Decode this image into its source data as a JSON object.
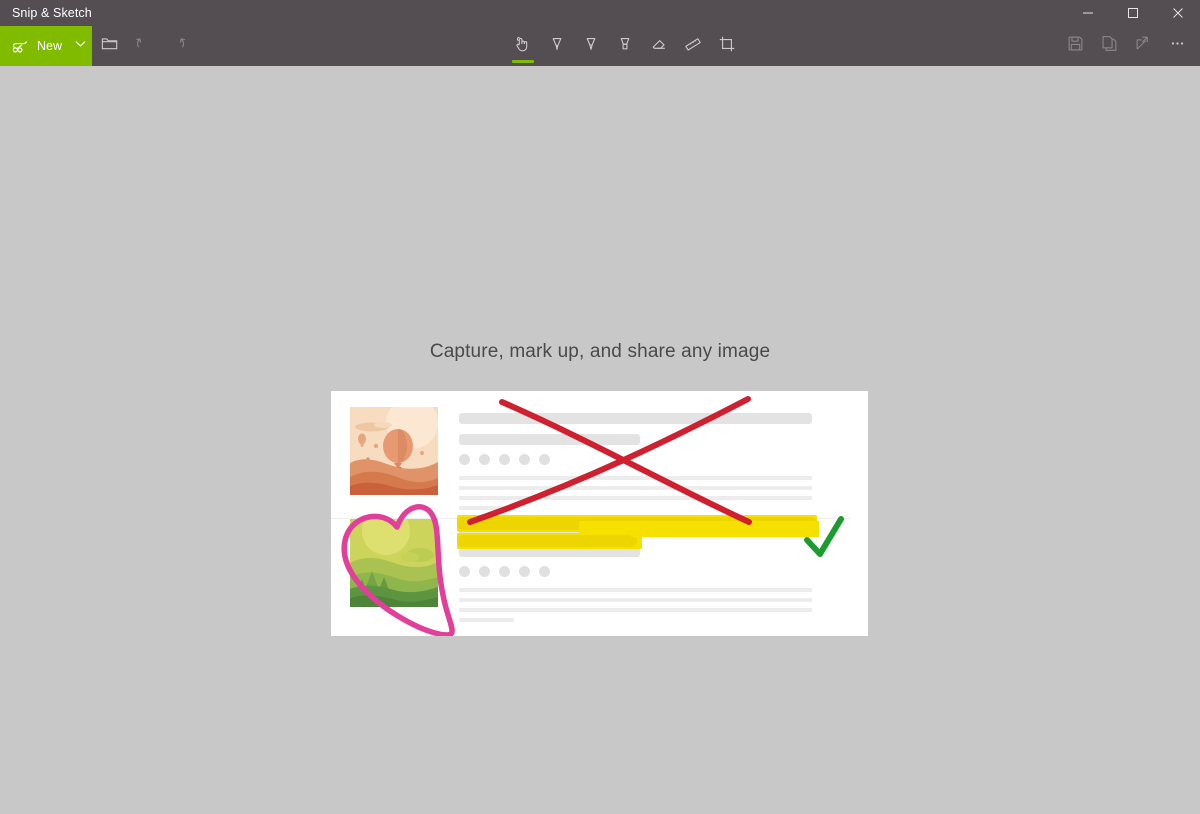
{
  "window": {
    "title": "Snip & Sketch",
    "titlebar_bg": "#544d52",
    "controls": [
      {
        "name": "minimize",
        "glyph": "minimize-icon"
      },
      {
        "name": "maximize",
        "glyph": "maximize-icon"
      },
      {
        "name": "close",
        "glyph": "close-icon"
      }
    ]
  },
  "toolbar": {
    "bg": "#544d52",
    "accent": "#80bb00",
    "new_label": "New",
    "new_icon": "snip-new-icon",
    "new_dropdown_icon": "chevron-down-icon",
    "left_tools": [
      {
        "name": "open-file-icon",
        "label": "Open file",
        "enabled": true
      },
      {
        "name": "undo-icon",
        "label": "Undo",
        "enabled": false
      },
      {
        "name": "redo-icon",
        "label": "Redo",
        "enabled": false
      }
    ],
    "center_tools": [
      {
        "name": "touch-writing-icon",
        "label": "Touch writing",
        "active": true
      },
      {
        "name": "ballpoint-pen-icon",
        "label": "Ballpoint pen",
        "active": false
      },
      {
        "name": "pencil-icon",
        "label": "Pencil",
        "active": false
      },
      {
        "name": "highlighter-icon",
        "label": "Highlighter",
        "active": false
      },
      {
        "name": "eraser-icon",
        "label": "Eraser",
        "active": false
      },
      {
        "name": "ruler-icon",
        "label": "Ruler",
        "active": false
      },
      {
        "name": "crop-icon",
        "label": "Image crop",
        "active": false
      }
    ],
    "right_tools": [
      {
        "name": "save-icon",
        "label": "Save as",
        "enabled": false
      },
      {
        "name": "copy-icon",
        "label": "Copy",
        "enabled": false
      },
      {
        "name": "share-icon",
        "label": "Share",
        "enabled": false
      },
      {
        "name": "more-icon",
        "label": "See more",
        "enabled": true
      }
    ]
  },
  "canvas": {
    "bg": "#c8c8c8",
    "tagline": "Capture, mark up, and share any image",
    "illustration": {
      "name": "markup-example-illustration",
      "card_bg": "#ffffff",
      "thumbnails": [
        {
          "name": "balloon-desert-thumbnail",
          "palette": [
            "#f5d4b4",
            "#f0c49f",
            "#e8a377",
            "#d9794e",
            "#c85f37"
          ]
        },
        {
          "name": "green-landscape-thumbnail",
          "palette": [
            "#cbd35a",
            "#b8c94f",
            "#9ab84e",
            "#7aa84a",
            "#5d9440"
          ]
        }
      ],
      "ink_annotations": [
        {
          "name": "red-cross-out-stroke",
          "color": "#cf2030",
          "tool": "ballpoint-pen"
        },
        {
          "name": "yellow-highlight-stroke",
          "color": "#f2e200",
          "tool": "highlighter"
        },
        {
          "name": "pink-heart-stroke",
          "color": "#e23f9a",
          "tool": "ballpoint-pen"
        },
        {
          "name": "green-check-stroke",
          "color": "#1a9c2f",
          "tool": "ballpoint-pen"
        }
      ]
    }
  }
}
